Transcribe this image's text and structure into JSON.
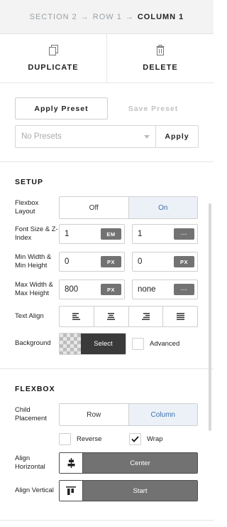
{
  "breadcrumb": {
    "section": "Section 2",
    "row": "Row 1",
    "column": "Column 1",
    "separator": "→"
  },
  "actions": {
    "duplicate": "Duplicate",
    "delete": "Delete"
  },
  "presets": {
    "apply_preset": "Apply Preset",
    "save_preset": "Save Preset",
    "select_placeholder": "No Presets",
    "apply": "Apply"
  },
  "setup": {
    "title": "Setup",
    "flexbox_layout": {
      "label": "Flexbox Layout",
      "options": [
        "Off",
        "On"
      ],
      "selected": "On"
    },
    "font_size_z": {
      "label": "Font Size & Z-Index",
      "font_value": "1",
      "font_unit": "EM",
      "z_value": "1",
      "z_unit": "···"
    },
    "min_wh": {
      "label": "Min Width & Min Height",
      "w_value": "0",
      "w_unit": "PX",
      "h_value": "0",
      "h_unit": "PX"
    },
    "max_wh": {
      "label": "Max Width & Max Height",
      "w_value": "800",
      "w_unit": "PX",
      "h_value": "none",
      "h_unit": "···"
    },
    "text_align": {
      "label": "Text Align",
      "options": [
        "left-align-icon",
        "center-align-icon",
        "right-align-icon",
        "justify-align-icon"
      ]
    },
    "background": {
      "label": "Background",
      "select": "Select",
      "advanced": "Advanced",
      "advanced_checked": false
    }
  },
  "flexbox": {
    "title": "Flexbox",
    "child_placement": {
      "label": "Child Placement",
      "options": [
        "Row",
        "Column"
      ],
      "selected": "Column"
    },
    "reverse": {
      "label": "Reverse",
      "checked": false
    },
    "wrap": {
      "label": "Wrap",
      "checked": true
    },
    "align_horizontal": {
      "label": "Align Horizontal",
      "value": "Center"
    },
    "align_vertical": {
      "label": "Align Vertical",
      "value": "Start"
    }
  },
  "colors": {
    "active_bg": "#ecf1f7",
    "active_text": "#3e6fae",
    "dark_unit": "#727272",
    "select_dark": "#3a3a3a"
  }
}
